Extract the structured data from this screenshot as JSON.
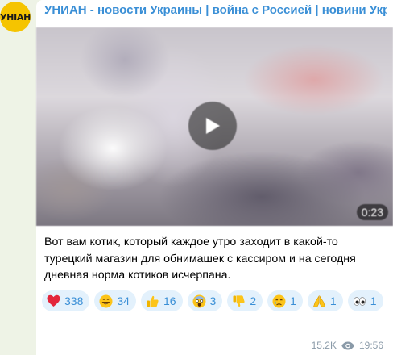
{
  "channel": {
    "title": "УНИАН - новости Украины | война с Россией | новини Україні...",
    "avatar_text": "УНІАН"
  },
  "video": {
    "duration": "0:23"
  },
  "message": {
    "text": "Вот вам котик, который каждое утро заходит в какой-то турецкий магазин для обнимашек с кассиром      и на сегодня дневная норма котиков исчерпана."
  },
  "reactions": [
    {
      "emoji": "heart-icon",
      "count": "338"
    },
    {
      "emoji": "grin-face-icon",
      "count": "34"
    },
    {
      "emoji": "thumbs-up-icon",
      "count": "16"
    },
    {
      "emoji": "scream-face-icon",
      "count": "3"
    },
    {
      "emoji": "thumbs-down-icon",
      "count": "2"
    },
    {
      "emoji": "cry-face-icon",
      "count": "1"
    },
    {
      "emoji": "pray-icon",
      "count": "1"
    },
    {
      "emoji": "eyes-icon",
      "count": "1"
    }
  ],
  "meta": {
    "views": "15.2K",
    "time": "19:56"
  },
  "colors": {
    "accent": "#3a8fd6",
    "avatar_bg": "#f5c400",
    "reaction_bg": "#e3f1fc"
  }
}
